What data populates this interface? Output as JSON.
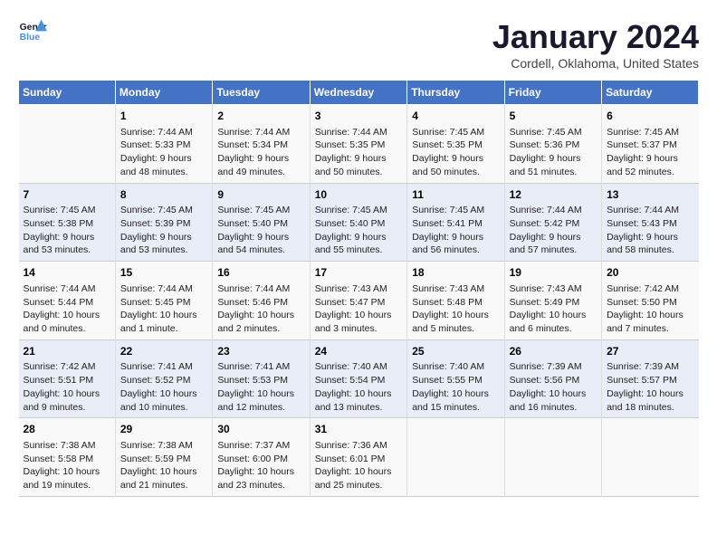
{
  "logo": {
    "line1": "General",
    "line2": "Blue"
  },
  "title": "January 2024",
  "subtitle": "Cordell, Oklahoma, United States",
  "days_header": [
    "Sunday",
    "Monday",
    "Tuesday",
    "Wednesday",
    "Thursday",
    "Friday",
    "Saturday"
  ],
  "weeks": [
    [
      {
        "day": "",
        "text": ""
      },
      {
        "day": "1",
        "text": "Sunrise: 7:44 AM\nSunset: 5:33 PM\nDaylight: 9 hours\nand 48 minutes."
      },
      {
        "day": "2",
        "text": "Sunrise: 7:44 AM\nSunset: 5:34 PM\nDaylight: 9 hours\nand 49 minutes."
      },
      {
        "day": "3",
        "text": "Sunrise: 7:44 AM\nSunset: 5:35 PM\nDaylight: 9 hours\nand 50 minutes."
      },
      {
        "day": "4",
        "text": "Sunrise: 7:45 AM\nSunset: 5:35 PM\nDaylight: 9 hours\nand 50 minutes."
      },
      {
        "day": "5",
        "text": "Sunrise: 7:45 AM\nSunset: 5:36 PM\nDaylight: 9 hours\nand 51 minutes."
      },
      {
        "day": "6",
        "text": "Sunrise: 7:45 AM\nSunset: 5:37 PM\nDaylight: 9 hours\nand 52 minutes."
      }
    ],
    [
      {
        "day": "7",
        "text": "Sunrise: 7:45 AM\nSunset: 5:38 PM\nDaylight: 9 hours\nand 53 minutes."
      },
      {
        "day": "8",
        "text": "Sunrise: 7:45 AM\nSunset: 5:39 PM\nDaylight: 9 hours\nand 53 minutes."
      },
      {
        "day": "9",
        "text": "Sunrise: 7:45 AM\nSunset: 5:40 PM\nDaylight: 9 hours\nand 54 minutes."
      },
      {
        "day": "10",
        "text": "Sunrise: 7:45 AM\nSunset: 5:40 PM\nDaylight: 9 hours\nand 55 minutes."
      },
      {
        "day": "11",
        "text": "Sunrise: 7:45 AM\nSunset: 5:41 PM\nDaylight: 9 hours\nand 56 minutes."
      },
      {
        "day": "12",
        "text": "Sunrise: 7:44 AM\nSunset: 5:42 PM\nDaylight: 9 hours\nand 57 minutes."
      },
      {
        "day": "13",
        "text": "Sunrise: 7:44 AM\nSunset: 5:43 PM\nDaylight: 9 hours\nand 58 minutes."
      }
    ],
    [
      {
        "day": "14",
        "text": "Sunrise: 7:44 AM\nSunset: 5:44 PM\nDaylight: 10 hours\nand 0 minutes."
      },
      {
        "day": "15",
        "text": "Sunrise: 7:44 AM\nSunset: 5:45 PM\nDaylight: 10 hours\nand 1 minute."
      },
      {
        "day": "16",
        "text": "Sunrise: 7:44 AM\nSunset: 5:46 PM\nDaylight: 10 hours\nand 2 minutes."
      },
      {
        "day": "17",
        "text": "Sunrise: 7:43 AM\nSunset: 5:47 PM\nDaylight: 10 hours\nand 3 minutes."
      },
      {
        "day": "18",
        "text": "Sunrise: 7:43 AM\nSunset: 5:48 PM\nDaylight: 10 hours\nand 5 minutes."
      },
      {
        "day": "19",
        "text": "Sunrise: 7:43 AM\nSunset: 5:49 PM\nDaylight: 10 hours\nand 6 minutes."
      },
      {
        "day": "20",
        "text": "Sunrise: 7:42 AM\nSunset: 5:50 PM\nDaylight: 10 hours\nand 7 minutes."
      }
    ],
    [
      {
        "day": "21",
        "text": "Sunrise: 7:42 AM\nSunset: 5:51 PM\nDaylight: 10 hours\nand 9 minutes."
      },
      {
        "day": "22",
        "text": "Sunrise: 7:41 AM\nSunset: 5:52 PM\nDaylight: 10 hours\nand 10 minutes."
      },
      {
        "day": "23",
        "text": "Sunrise: 7:41 AM\nSunset: 5:53 PM\nDaylight: 10 hours\nand 12 minutes."
      },
      {
        "day": "24",
        "text": "Sunrise: 7:40 AM\nSunset: 5:54 PM\nDaylight: 10 hours\nand 13 minutes."
      },
      {
        "day": "25",
        "text": "Sunrise: 7:40 AM\nSunset: 5:55 PM\nDaylight: 10 hours\nand 15 minutes."
      },
      {
        "day": "26",
        "text": "Sunrise: 7:39 AM\nSunset: 5:56 PM\nDaylight: 10 hours\nand 16 minutes."
      },
      {
        "day": "27",
        "text": "Sunrise: 7:39 AM\nSunset: 5:57 PM\nDaylight: 10 hours\nand 18 minutes."
      }
    ],
    [
      {
        "day": "28",
        "text": "Sunrise: 7:38 AM\nSunset: 5:58 PM\nDaylight: 10 hours\nand 19 minutes."
      },
      {
        "day": "29",
        "text": "Sunrise: 7:38 AM\nSunset: 5:59 PM\nDaylight: 10 hours\nand 21 minutes."
      },
      {
        "day": "30",
        "text": "Sunrise: 7:37 AM\nSunset: 6:00 PM\nDaylight: 10 hours\nand 23 minutes."
      },
      {
        "day": "31",
        "text": "Sunrise: 7:36 AM\nSunset: 6:01 PM\nDaylight: 10 hours\nand 25 minutes."
      },
      {
        "day": "",
        "text": ""
      },
      {
        "day": "",
        "text": ""
      },
      {
        "day": "",
        "text": ""
      }
    ]
  ]
}
